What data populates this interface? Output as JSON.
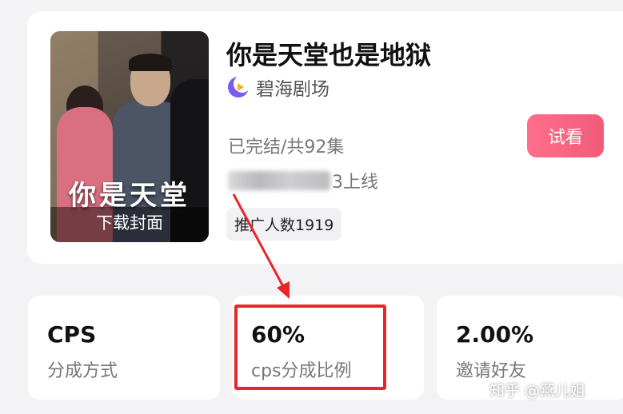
{
  "drama": {
    "title": "你是天堂也是地狱",
    "cover_title": "你是天堂",
    "cover_action": "下载封面",
    "theater_icon": "crescent-moon-play-icon",
    "theater_name": "碧海剧场",
    "status": "已完结/共92集",
    "online_suffix": "3上线",
    "promoters": "推广人数1919",
    "try_button": "试看"
  },
  "stats": [
    {
      "value": "CPS",
      "label": "分成方式"
    },
    {
      "value": "60%",
      "label": "cps分成比例"
    },
    {
      "value": "2.00%",
      "label": "邀请好友"
    }
  ],
  "watermark": "知乎 @燕儿姐",
  "colors": {
    "accent": "#f25a7a",
    "annotation": "#e8262b",
    "theater_logo": "#7a5cf0"
  }
}
